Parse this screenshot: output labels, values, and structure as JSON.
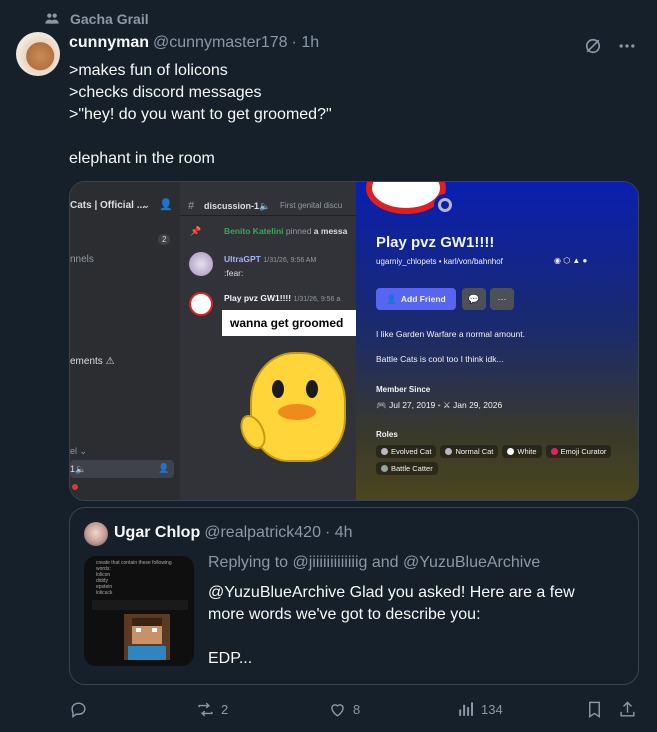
{
  "community": {
    "label": "Gacha Grail"
  },
  "tweet": {
    "display_name": "cunnyman",
    "handle": "@cunnymaster178",
    "time": "· 1h",
    "lines": [
      ">makes fun of lolicons",
      ">checks discord messages",
      ">\"hey! do you want to get groomed?\"",
      "",
      "elephant in the room"
    ]
  },
  "embed": {
    "server_name": "Cats | Official ...",
    "channels_label": "nnels",
    "announcements_label": "ements ⚠",
    "channel_name": "discussion-1🔈",
    "channel_topic": "First genital discu",
    "pin_user": "Benito Katelini",
    "pin_text": "pinned",
    "pin_msg": "a messa",
    "msg1_user": "UltraGPT",
    "msg1_time": "1/31/26, 9:56 AM",
    "msg1_text": ":fear:",
    "msg2_user": "Play pvz GW1!!!!",
    "msg2_time": "1/31/26, 9:56 a",
    "msg2_banner": "wanna get groomed",
    "badge_count": "2",
    "profile_name": "Play pvz GW1!!!!",
    "profile_tags": "ugarniy_chlopets • karl/von/bahnhof",
    "add_friend": "Add Friend",
    "bio1": "I like Garden Warfare a normal amount.",
    "bio2": "Battle Cats is cool too I think idk...",
    "member_since_label": "Member Since",
    "member_since_discord": "Jul 27, 2019",
    "member_since_server": "Jan 29, 2026",
    "roles_label": "Roles",
    "roles": [
      {
        "name": "Evolved Cat",
        "color": "#b5bac1"
      },
      {
        "name": "Normal Cat",
        "color": "#b5bac1"
      },
      {
        "name": "White",
        "color": "#ffffff"
      },
      {
        "name": "Emoji Curator",
        "color": "#e91e63"
      },
      {
        "name": "Battle Catter",
        "color": "#95a5a6"
      }
    ]
  },
  "quote": {
    "display_name": "Ugar Chlop",
    "handle": "@realpatrick420",
    "time": "· 4h",
    "reply_prefix": "Replying to",
    "reply_user1": "@jiiiiiiiiiiiiig",
    "reply_and": "and",
    "reply_user2": "@YuzuBlueArchive",
    "body_lines": [
      "@YuzuBlueArchive Glad you asked! Here are a few",
      "more words we've got to describe you:",
      "",
      "EDP..."
    ],
    "thumb_lines": [
      "create that contain these following",
      "words:",
      "lolicon",
      "diddy",
      "epstein",
      "lolicuck"
    ]
  },
  "actions": {
    "replies": "",
    "reposts": "2",
    "likes": "8",
    "views": "134"
  },
  "colors": {
    "background": "#15202b",
    "text_secondary": "#8b98a5",
    "border": "#38444d",
    "discord_blurple": "#248046"
  }
}
